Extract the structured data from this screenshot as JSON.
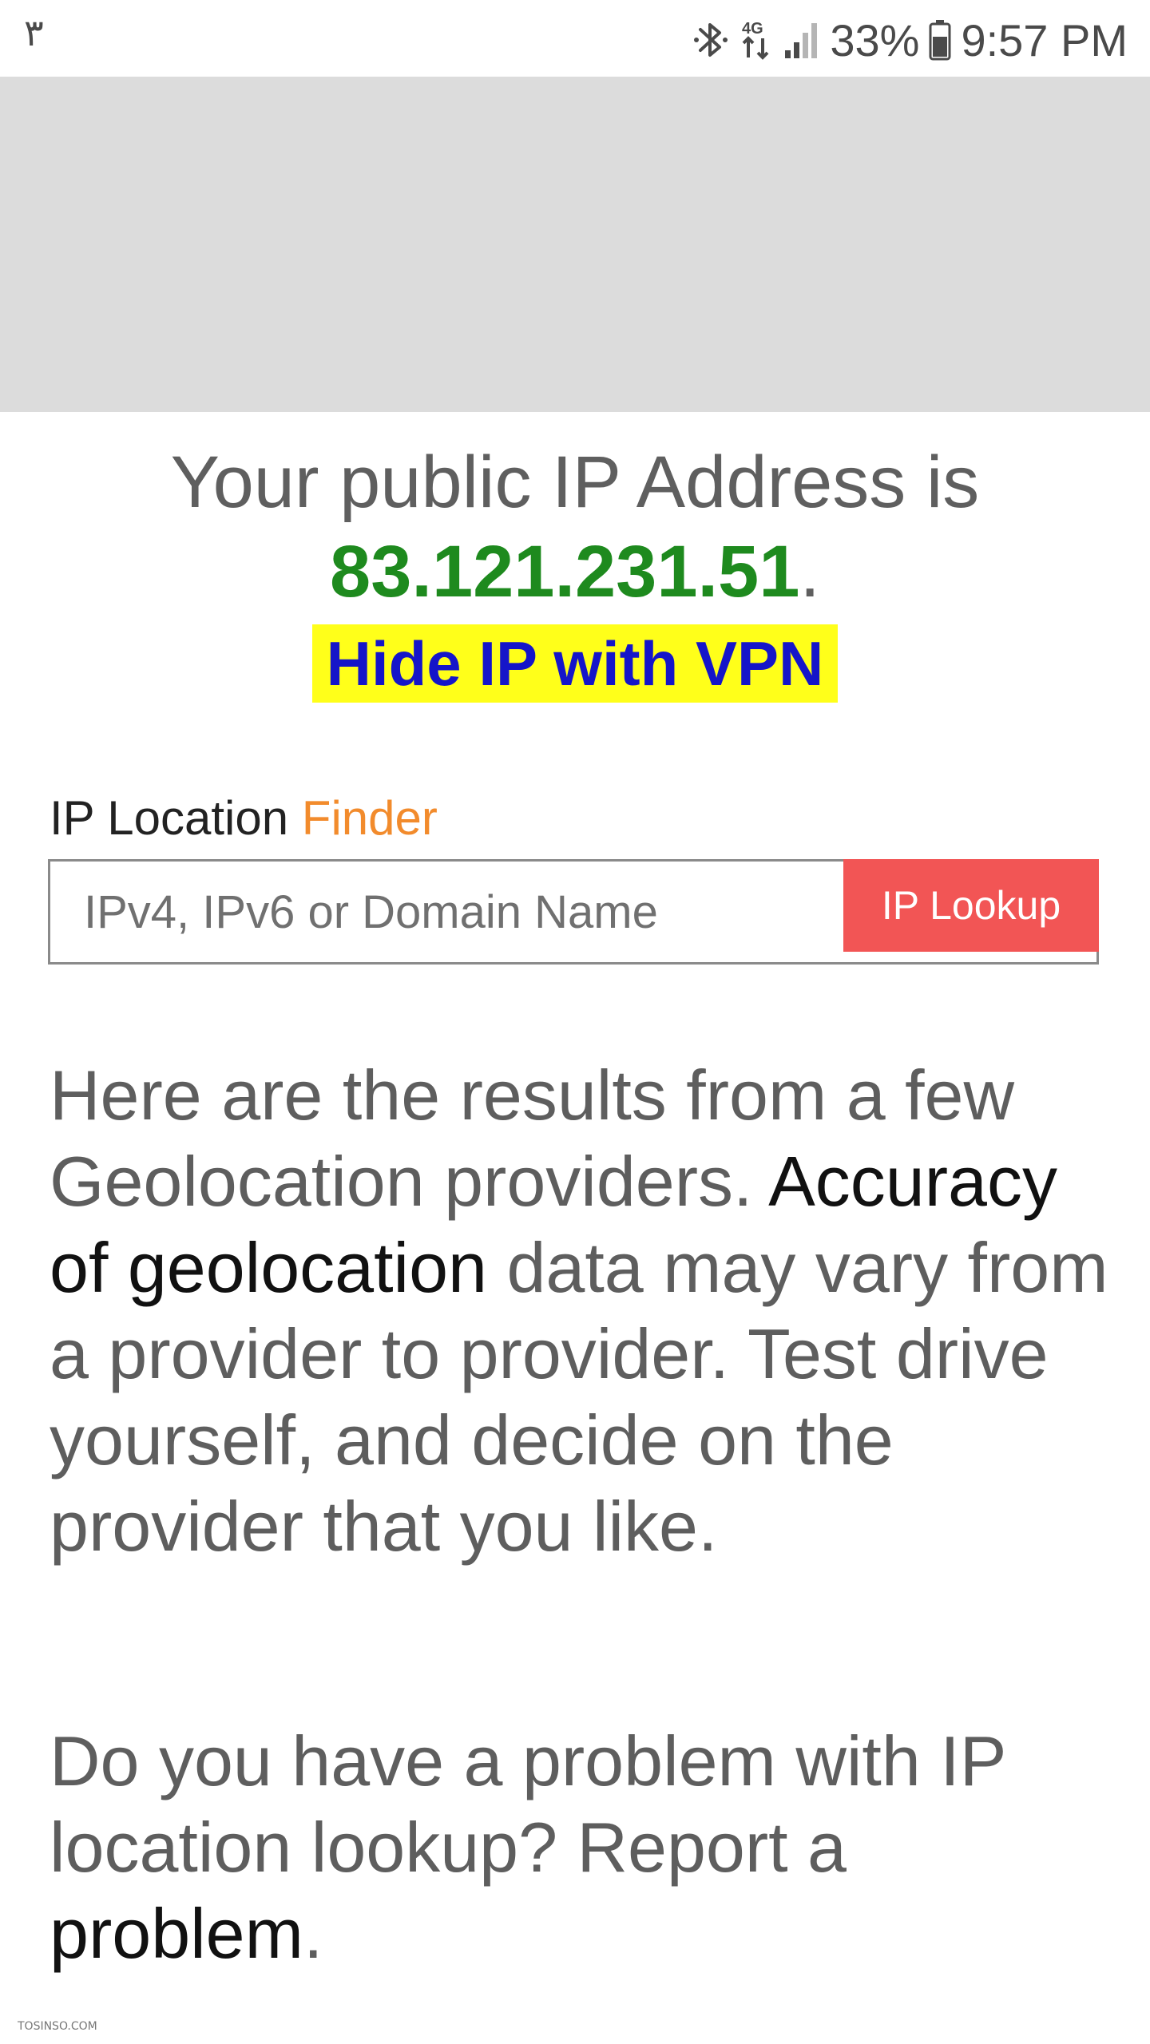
{
  "status_bar": {
    "left_text": "٣",
    "battery": "33%",
    "time": "9:57 PM",
    "network": "4G",
    "icons": [
      "bluetooth-icon",
      "data-arrows-icon",
      "signal-icon",
      "battery-icon"
    ]
  },
  "headline": {
    "prefix": "Your public IP Address is",
    "ip": "83.121.231.51",
    "suffix": "."
  },
  "vpn_link": "Hide IP with VPN",
  "finder": {
    "label_main": "IP Location",
    "label_accent": "Finder",
    "placeholder": "IPv4, IPv6 or Domain Name",
    "button": "IP Lookup"
  },
  "results_paragraph": {
    "part1": "Here are the results from a few Geolocation providers.",
    "link": "Accuracy of geolocation",
    "part2": "data may vary from a provider to provider. Test drive yourself, and decide on the provider that you like."
  },
  "report_paragraph": {
    "part1": "Do you have a problem with IP location lookup? Report a",
    "link": "problem",
    "suffix": "."
  },
  "watermark": "TOSINSO.COM",
  "colors": {
    "ip_green": "#1e8a1e",
    "vpn_highlight": "#ffff1a",
    "vpn_text": "#1515c9",
    "finder_accent": "#f28b2c",
    "lookup_button": "#f25555",
    "ad_placeholder": "#dcdcdc"
  }
}
